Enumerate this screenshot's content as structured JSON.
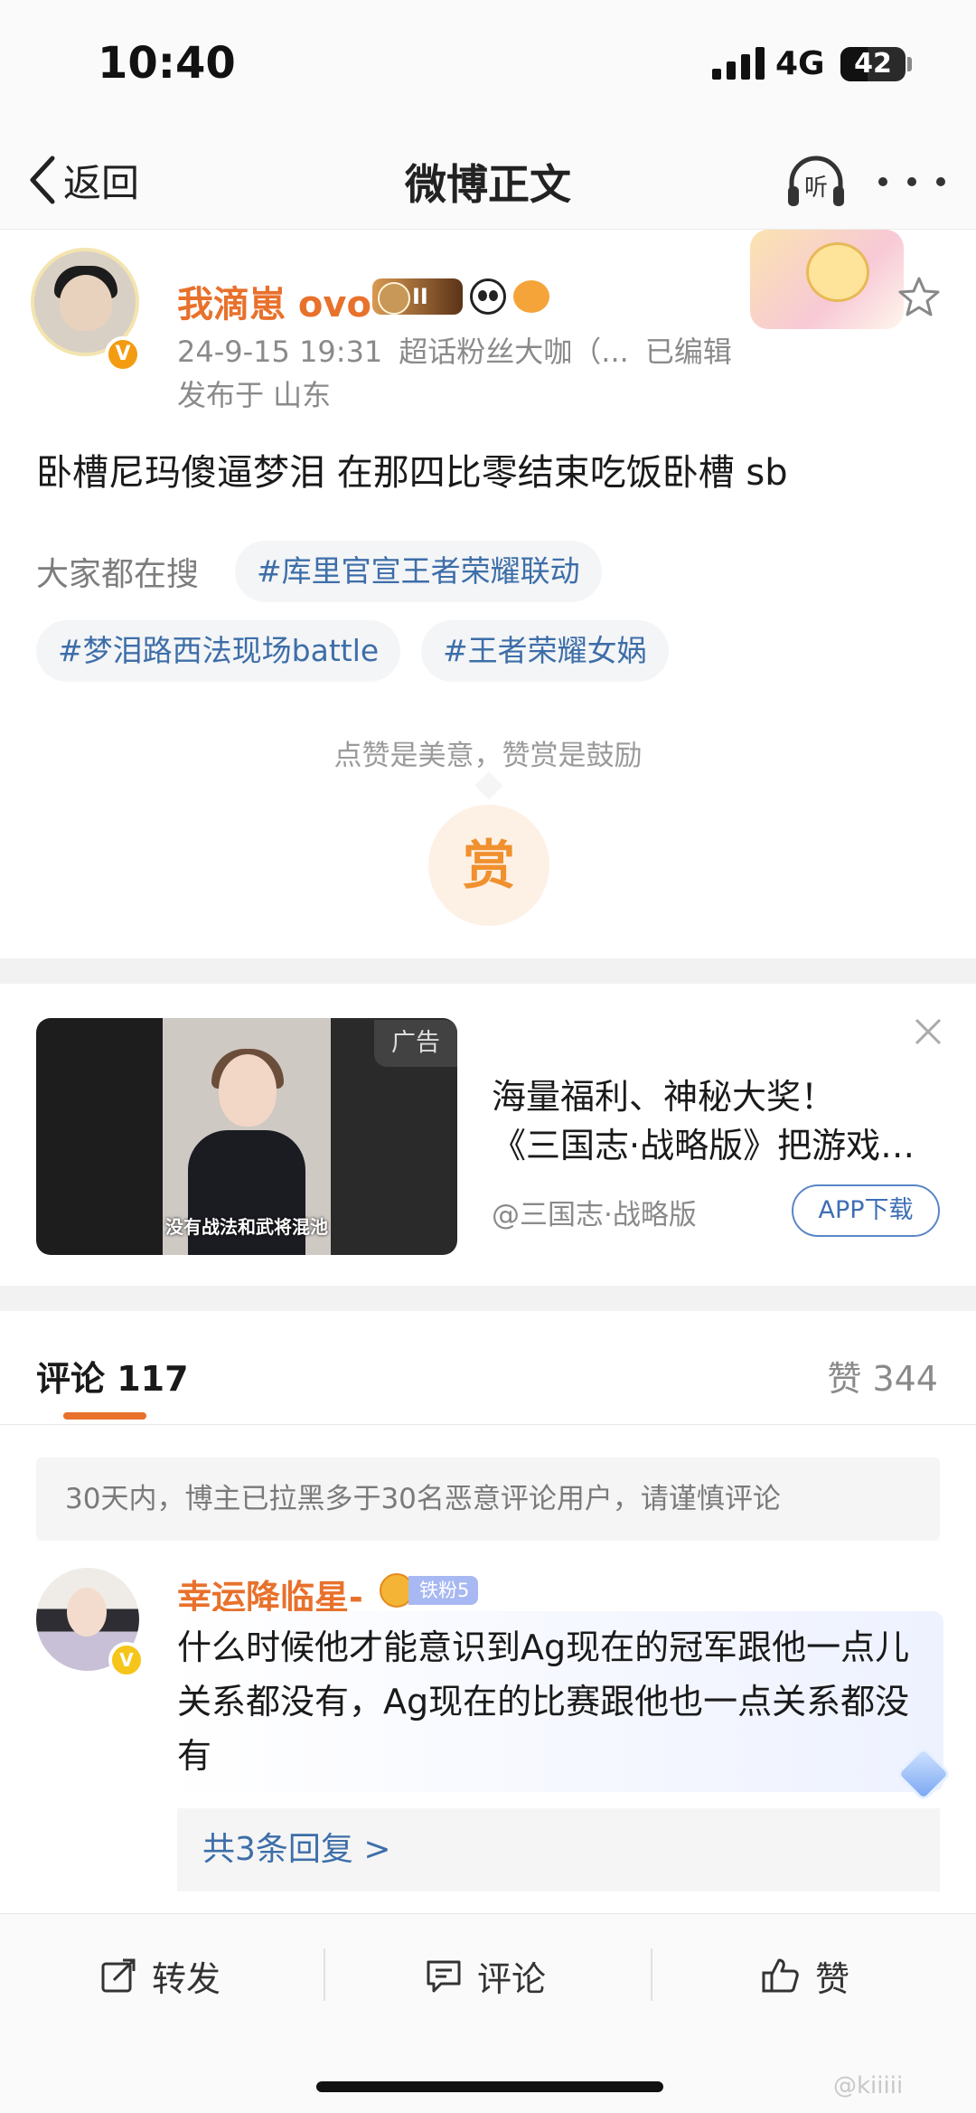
{
  "status_bar": {
    "time": "10:40",
    "network": "4G",
    "battery": "42",
    "battery_level_percent": 42
  },
  "nav": {
    "back_label": "返回",
    "title": "微博正文",
    "listen_label": "听"
  },
  "post": {
    "author": "我滴崽 ovo",
    "level_badge": "II",
    "meta": {
      "date": "24-9-15 19:31",
      "source": "超话粉丝大咖（...",
      "edited": "已编辑"
    },
    "location": "发布于 山东",
    "text": "卧槽尼玛傻逼梦泪 在那四比零结束吃饭卧槽 sb",
    "search_label": "大家都在搜",
    "hot_tags": [
      "#库里官宣王者荣耀联动",
      "#梦泪路西法现场battle",
      "#王者荣耀女娲"
    ],
    "reward_hint": "点赞是美意，赞赏是鼓励",
    "reward_button": "赏",
    "verified_mark": "V"
  },
  "ad": {
    "tag": "广告",
    "video_subtitle": "没有战法和武将混池",
    "title_line1": "海量福利、神秘大奖！",
    "title_line2": "《三国志·战略版》把游戏福利送给你",
    "source": "@三国志·战略版",
    "download_label": "APP下载"
  },
  "comments": {
    "tab_label": "评论 117",
    "likes_label": "赞 344",
    "notice": "30天内，博主已拉黑多于30名恶意评论用户，请谨慎评论",
    "items": [
      {
        "name": "幸运降临星-",
        "fan_badge": "铁粉5",
        "verified_mark": "V",
        "text": "什么时候他才能意识到Ag现在的冠军跟他一点儿关系都没有，Ag现在的比赛跟他也一点关系都没有",
        "replies_label": "共3条回复 >"
      }
    ]
  },
  "bottom_bar": {
    "repost": "转发",
    "comment": "评论",
    "like": "赞"
  },
  "watermark": "@kiiiii",
  "colors": {
    "accent_orange": "#e8712c",
    "link_blue": "#3d6ea8",
    "reward_orange": "#f0902e"
  }
}
